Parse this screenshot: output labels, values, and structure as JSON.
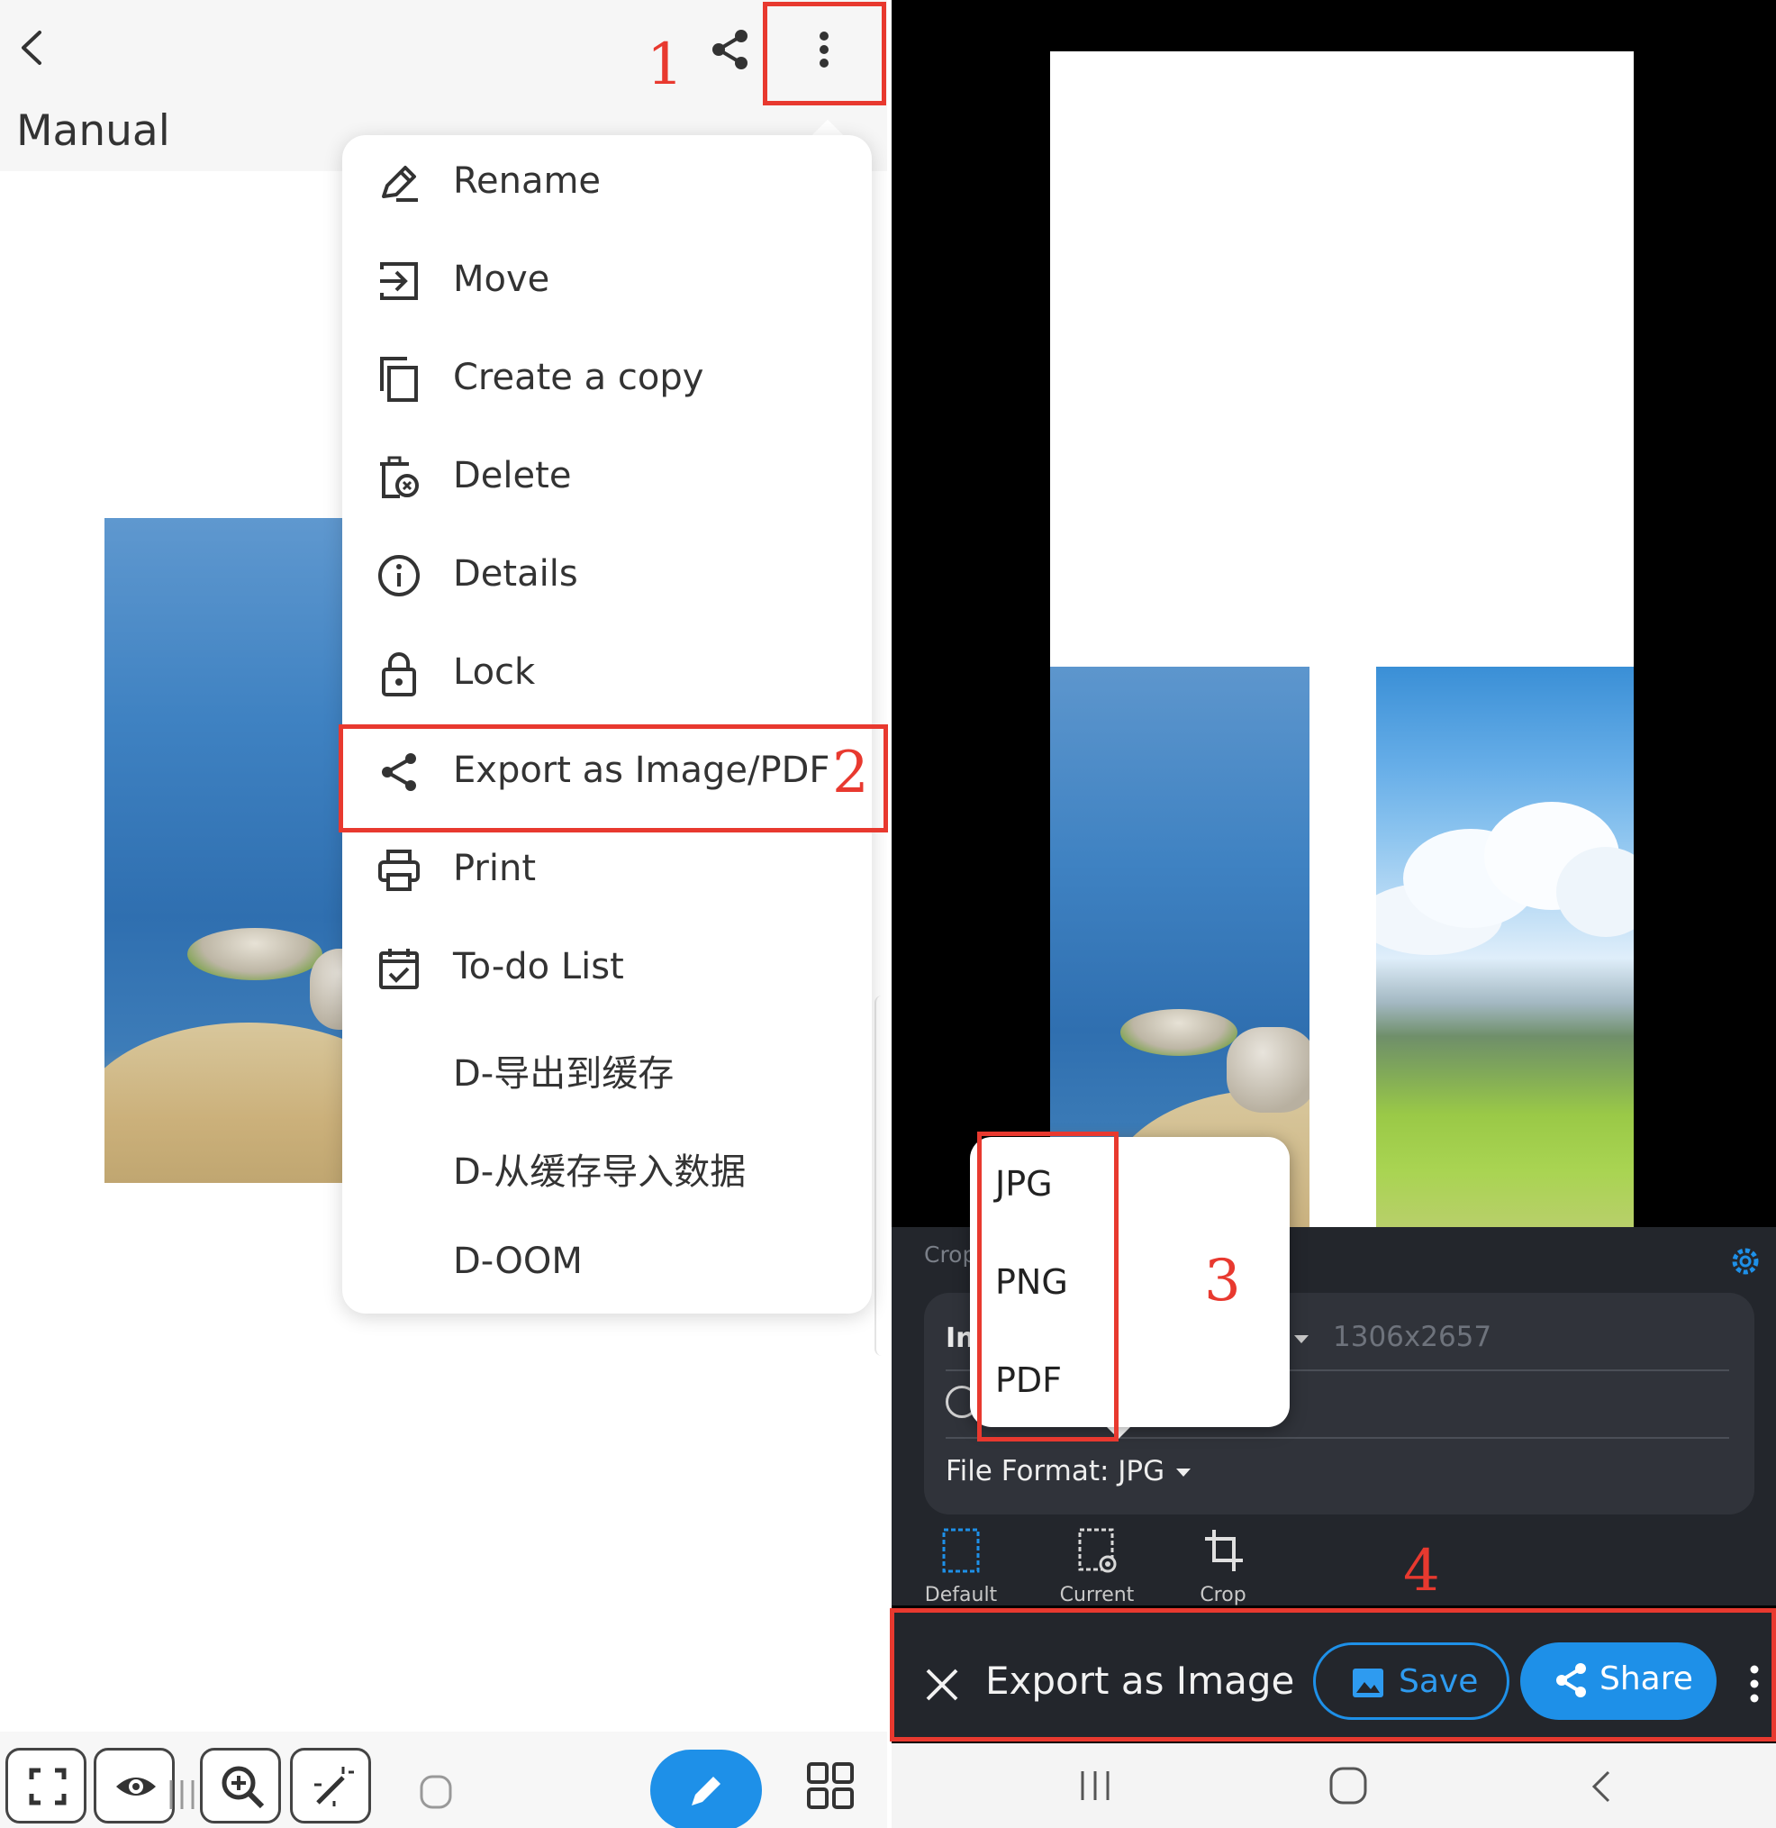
{
  "left_screen": {
    "title": "Manual",
    "menu_items": [
      {
        "label": "Rename",
        "icon": "rename-icon"
      },
      {
        "label": "Move",
        "icon": "move-icon"
      },
      {
        "label": "Create a copy",
        "icon": "copy-icon"
      },
      {
        "label": "Delete",
        "icon": "delete-icon"
      },
      {
        "label": "Details",
        "icon": "info-icon"
      },
      {
        "label": "Lock",
        "icon": "lock-icon"
      },
      {
        "label": "Export as Image/PDF",
        "icon": "share-icon"
      },
      {
        "label": "Print",
        "icon": "print-icon"
      },
      {
        "label": "To-do List",
        "icon": "todo-icon"
      },
      {
        "label": "D-导出到缓存",
        "icon": ""
      },
      {
        "label": "D-从缓存导入数据",
        "icon": ""
      },
      {
        "label": "D-OOM",
        "icon": ""
      }
    ],
    "toolbar_icons": [
      "fullscreen-icon",
      "eye-icon",
      "zoom-in-icon",
      "magic-wand-icon",
      "circle-icon",
      "pen-icon",
      "grid-icon"
    ]
  },
  "right_screen": {
    "sheet_label": "Crop",
    "image_type_prefix": "In",
    "resolution": "1306x2657",
    "file_format_label": "File Format: JPG",
    "format_options": [
      "JPG",
      "PNG",
      "PDF"
    ],
    "modes": [
      {
        "label": "Default",
        "icon": "default-frame-icon"
      },
      {
        "label": "Current View",
        "icon": "current-view-icon"
      },
      {
        "label": "Crop",
        "icon": "crop-icon"
      }
    ],
    "action_bar": {
      "title": "Export as Image",
      "save_label": "Save",
      "share_label": "Share"
    }
  },
  "annotations": [
    "1",
    "2",
    "3",
    "4"
  ],
  "colors": {
    "accent_blue": "#1e90e8",
    "annotation_red": "#e8392f",
    "dark_sheet": "#23262c"
  }
}
